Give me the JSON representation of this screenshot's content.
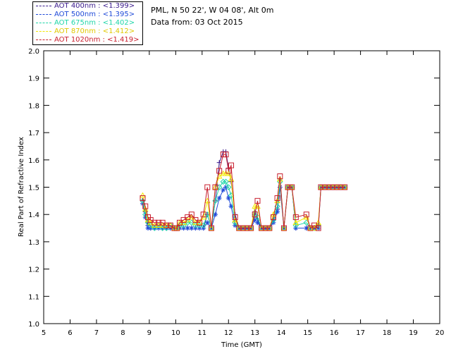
{
  "header": {
    "location": "PML, N 50 22', W 04 08', Alt 0m",
    "date": "Data from: 03 Oct 2015"
  },
  "legend": [
    {
      "label": "AOT  400nm : <1.399>",
      "color": "#3a1a8c"
    },
    {
      "label": "AOT  500nm : <1.395>",
      "color": "#1f4ad8"
    },
    {
      "label": "AOT  675nm : <1.402>",
      "color": "#1fd6a8"
    },
    {
      "label": "AOT  870nm : <1.412>",
      "color": "#f2e600"
    },
    {
      "label": "AOT 1020nm : <1.419>",
      "color": "#c81e2d"
    }
  ],
  "chart_data": {
    "type": "line",
    "xlabel": "Time (GMT)",
    "ylabel": "Real Part of Refractive Index",
    "xlim": [
      5,
      20
    ],
    "ylim": [
      1.0,
      2.0
    ],
    "xticks": [
      "5",
      "6",
      "7",
      "8",
      "9",
      "10",
      "11",
      "12",
      "13",
      "14",
      "15",
      "16",
      "17",
      "18",
      "19",
      "20"
    ],
    "yticks": [
      "1.0",
      "1.1",
      "1.2",
      "1.3",
      "1.4",
      "1.5",
      "1.6",
      "1.7",
      "1.8",
      "1.9",
      "2.0"
    ],
    "x": [
      8.75,
      8.85,
      8.95,
      9.05,
      9.2,
      9.35,
      9.5,
      9.65,
      9.8,
      9.95,
      10.05,
      10.15,
      10.3,
      10.45,
      10.6,
      10.75,
      10.9,
      11.05,
      11.2,
      11.35,
      11.5,
      11.65,
      11.8,
      11.9,
      12.0,
      12.1,
      12.25,
      12.4,
      12.55,
      12.7,
      12.85,
      13.0,
      13.1,
      13.25,
      13.4,
      13.55,
      13.7,
      13.85,
      13.95,
      14.1,
      14.25,
      14.4,
      14.55,
      14.95,
      15.1,
      15.25,
      15.4,
      15.5,
      15.65,
      15.8,
      15.95,
      16.1,
      16.25,
      16.4
    ],
    "series": [
      {
        "name": "AOT 400nm",
        "color": "#3a1a8c",
        "marker": "plus",
        "values": [
          1.45,
          1.41,
          1.36,
          1.35,
          1.35,
          1.35,
          1.35,
          1.35,
          1.35,
          1.35,
          1.35,
          1.35,
          1.35,
          1.35,
          1.35,
          1.35,
          1.35,
          1.35,
          1.4,
          1.35,
          1.45,
          1.59,
          1.63,
          1.63,
          1.57,
          1.52,
          1.4,
          1.35,
          1.35,
          1.35,
          1.35,
          1.41,
          1.38,
          1.35,
          1.35,
          1.35,
          1.38,
          1.42,
          1.53,
          1.35,
          1.5,
          1.5,
          1.35,
          1.35,
          1.35,
          1.35,
          1.36,
          1.5,
          1.5,
          1.5,
          1.5,
          1.5,
          1.5,
          1.5
        ]
      },
      {
        "name": "AOT 500nm",
        "color": "#1f4ad8",
        "marker": "star",
        "values": [
          1.44,
          1.39,
          1.35,
          1.35,
          1.35,
          1.35,
          1.35,
          1.35,
          1.35,
          1.35,
          1.35,
          1.35,
          1.35,
          1.35,
          1.35,
          1.35,
          1.35,
          1.35,
          1.37,
          1.35,
          1.4,
          1.46,
          1.49,
          1.5,
          1.46,
          1.43,
          1.36,
          1.35,
          1.35,
          1.35,
          1.35,
          1.38,
          1.37,
          1.35,
          1.35,
          1.35,
          1.37,
          1.41,
          1.5,
          1.35,
          1.5,
          1.5,
          1.35,
          1.35,
          1.35,
          1.35,
          1.35,
          1.5,
          1.5,
          1.5,
          1.5,
          1.5,
          1.5,
          1.5
        ]
      },
      {
        "name": "AOT 675nm",
        "color": "#1fd6a8",
        "marker": "diamond",
        "values": [
          1.45,
          1.4,
          1.37,
          1.36,
          1.35,
          1.36,
          1.35,
          1.35,
          1.36,
          1.35,
          1.35,
          1.36,
          1.36,
          1.37,
          1.37,
          1.36,
          1.36,
          1.36,
          1.4,
          1.35,
          1.45,
          1.5,
          1.52,
          1.52,
          1.5,
          1.47,
          1.37,
          1.35,
          1.35,
          1.35,
          1.35,
          1.4,
          1.39,
          1.35,
          1.35,
          1.35,
          1.38,
          1.43,
          1.52,
          1.35,
          1.5,
          1.5,
          1.36,
          1.37,
          1.35,
          1.35,
          1.36,
          1.5,
          1.5,
          1.5,
          1.5,
          1.5,
          1.5,
          1.5
        ]
      },
      {
        "name": "AOT 870nm",
        "color": "#f2e600",
        "marker": "triangle",
        "values": [
          1.47,
          1.42,
          1.38,
          1.37,
          1.36,
          1.36,
          1.36,
          1.36,
          1.36,
          1.35,
          1.35,
          1.37,
          1.37,
          1.38,
          1.39,
          1.37,
          1.37,
          1.39,
          1.45,
          1.35,
          1.5,
          1.54,
          1.55,
          1.55,
          1.55,
          1.53,
          1.38,
          1.35,
          1.35,
          1.35,
          1.35,
          1.43,
          1.43,
          1.35,
          1.35,
          1.35,
          1.4,
          1.45,
          1.53,
          1.35,
          1.5,
          1.5,
          1.37,
          1.39,
          1.35,
          1.35,
          1.37,
          1.5,
          1.5,
          1.5,
          1.5,
          1.5,
          1.5,
          1.5
        ]
      },
      {
        "name": "AOT 1020nm",
        "color": "#c81e2d",
        "marker": "square",
        "values": [
          1.46,
          1.43,
          1.39,
          1.38,
          1.37,
          1.37,
          1.37,
          1.36,
          1.36,
          1.35,
          1.35,
          1.37,
          1.38,
          1.39,
          1.4,
          1.38,
          1.37,
          1.4,
          1.5,
          1.35,
          1.5,
          1.56,
          1.62,
          1.62,
          1.56,
          1.58,
          1.39,
          1.35,
          1.35,
          1.35,
          1.35,
          1.4,
          1.45,
          1.35,
          1.35,
          1.35,
          1.39,
          1.46,
          1.54,
          1.35,
          1.5,
          1.5,
          1.39,
          1.4,
          1.35,
          1.36,
          1.35,
          1.5,
          1.5,
          1.5,
          1.5,
          1.5,
          1.5,
          1.5
        ]
      }
    ]
  }
}
